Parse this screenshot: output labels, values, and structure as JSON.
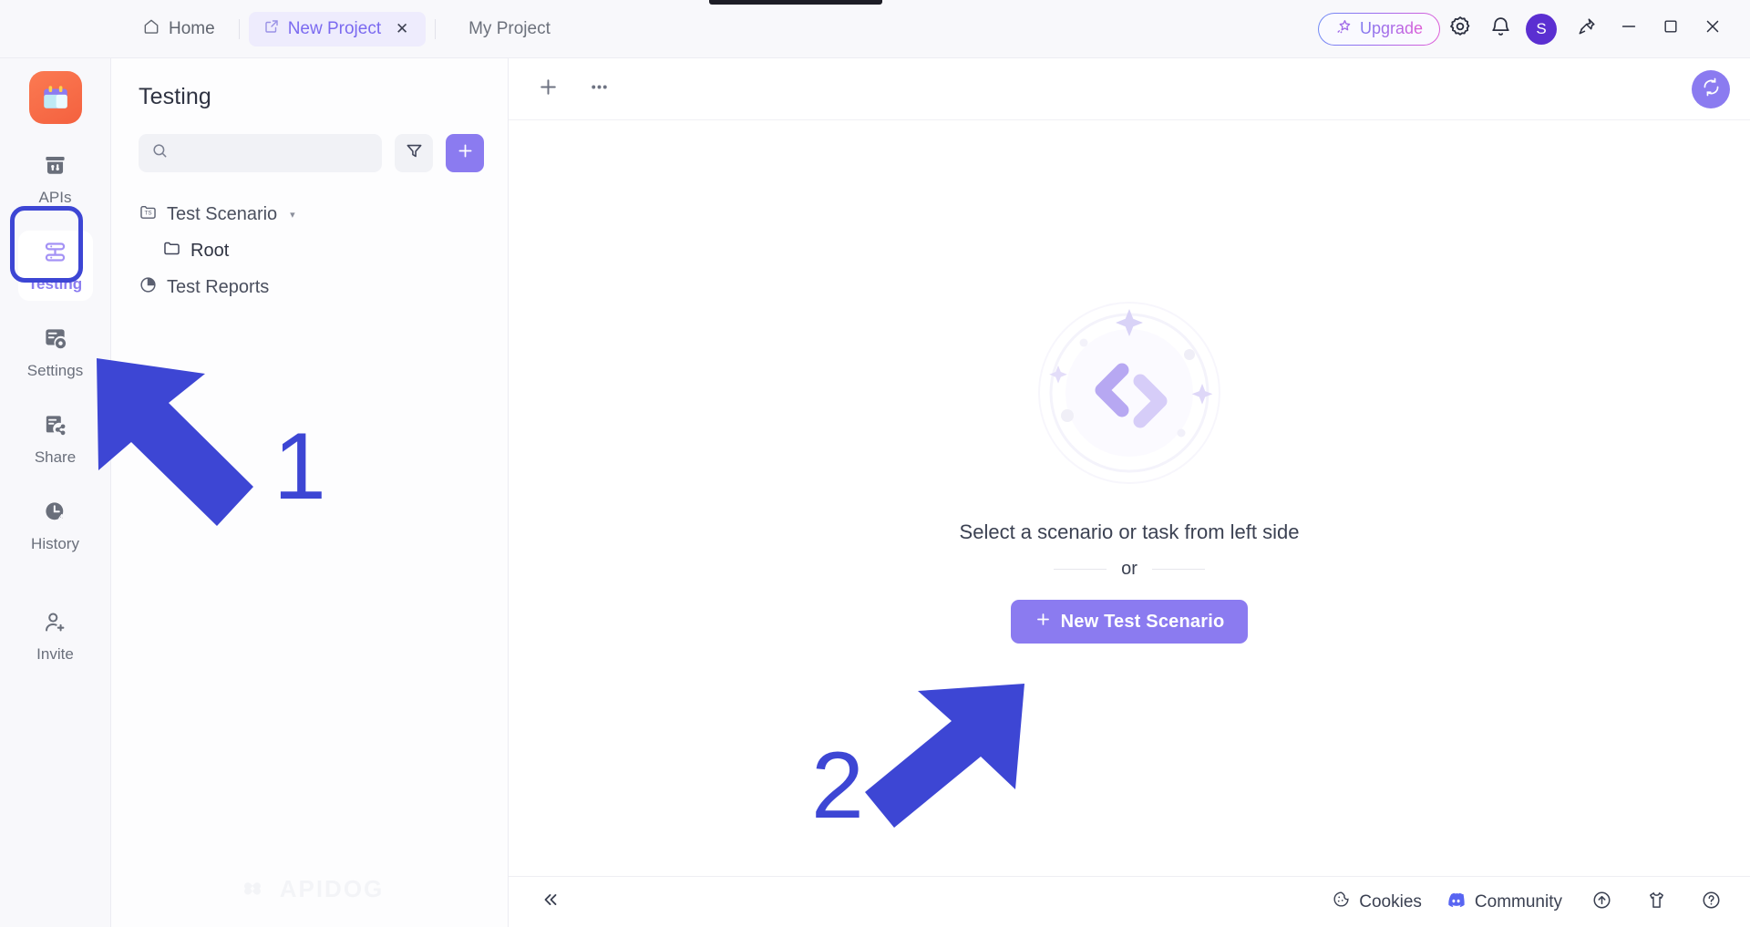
{
  "titlebar": {
    "tabs": [
      {
        "label": "Home",
        "icon": "home-icon",
        "active": false
      },
      {
        "label": "New Project",
        "icon": "external-link-icon",
        "active": true,
        "close": "✕"
      }
    ],
    "project_label": "My Project",
    "upgrade_label": "Upgrade",
    "upgrade_icon": "magic-star-icon",
    "settings_icon": "gear-icon",
    "notification_icon": "bell-icon",
    "avatar_initial": "S",
    "avatar_color": "#5b2fd1",
    "window_controls": [
      {
        "name": "pin-button",
        "glyph": "pin-icon"
      },
      {
        "name": "minimize-button",
        "glyph": "minimize-icon"
      },
      {
        "name": "maximize-button",
        "glyph": "maximize-icon"
      },
      {
        "name": "close-button",
        "glyph": "close-icon"
      }
    ]
  },
  "rail": {
    "app_logo_icon": "apidog-calendar-logo",
    "items": [
      {
        "label": "APIs",
        "icon": "apis-icon",
        "active": false
      },
      {
        "label": "Testing",
        "icon": "testing-icon",
        "active": true
      },
      {
        "label": "Settings",
        "icon": "settings-icon",
        "active": false
      },
      {
        "label": "Share",
        "icon": "share-icon",
        "active": false
      },
      {
        "label": "History",
        "icon": "history-icon",
        "active": false
      },
      {
        "label": "Invite",
        "icon": "invite-icon",
        "active": false
      }
    ]
  },
  "panel": {
    "title": "Testing",
    "search": {
      "value": "",
      "placeholder": "",
      "icon": "search-icon"
    },
    "filter_icon": "filter-funnel-icon",
    "add_icon": "plus-icon",
    "tree": [
      {
        "label": "Test Scenario",
        "icon": "test-scenario-icon",
        "caret": "▾",
        "indent": 0
      },
      {
        "label": "Root",
        "icon": "folder-icon",
        "indent": 1
      },
      {
        "label": "Test Reports",
        "icon": "pie-chart-icon",
        "indent": 0
      }
    ],
    "watermark": "APIDOG"
  },
  "main": {
    "toolbar": {
      "add_icon": "plus-icon",
      "more_icon": "ellipsis-icon",
      "sync_icon": "sync-icon"
    },
    "empty_state": {
      "art_icon": "code-brackets-icon",
      "message": "Select a scenario or task from left side",
      "or_label": "or",
      "cta_label": "New Test Scenario",
      "cta_icon": "plus-icon"
    }
  },
  "statusbar": {
    "collapse_icon": "chevron-double-left-icon",
    "items": [
      {
        "label": "Cookies",
        "icon": "cookie-icon"
      },
      {
        "label": "Community",
        "icon": "discord-icon"
      }
    ],
    "icon_buttons": [
      {
        "name": "upload-circle-button",
        "icon": "arrow-up-circle-icon"
      },
      {
        "name": "tshirt-button",
        "icon": "tshirt-icon"
      },
      {
        "name": "help-button",
        "icon": "question-circle-icon"
      }
    ]
  },
  "annotations": {
    "color": "#3d46d4",
    "steps": [
      {
        "number": "1",
        "target": "rail-item-testing"
      },
      {
        "number": "2",
        "target": "new-test-scenario-button"
      }
    ]
  },
  "colors": {
    "accent": "#8b7bf0",
    "accent_soft": "#eeecfd",
    "annotation": "#3d46d4",
    "app_logo": "#f4613f",
    "avatar": "#5b2fd1",
    "discord": "#5865f2"
  }
}
